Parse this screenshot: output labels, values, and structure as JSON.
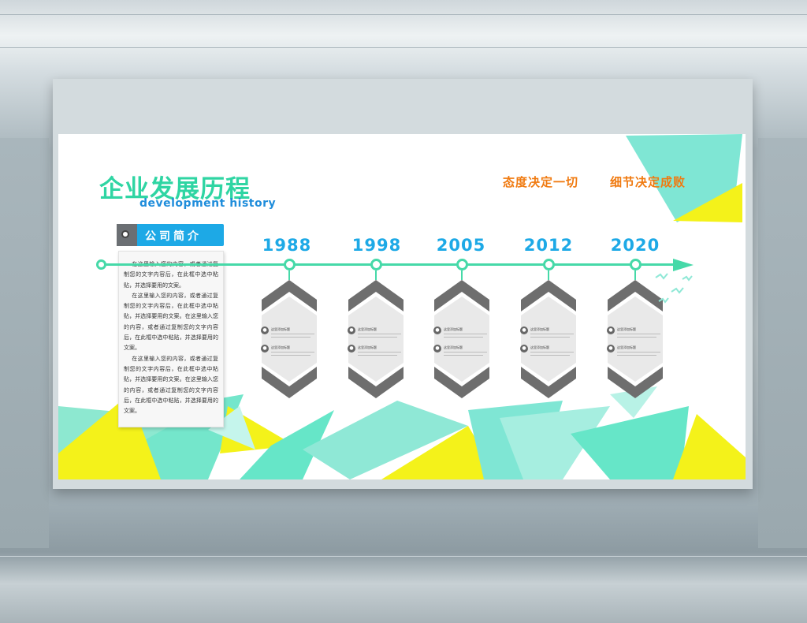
{
  "colors": {
    "teal": "#2fd5a3",
    "blue": "#1da9e6",
    "orange": "#f07a10",
    "yellow": "#f4f21a",
    "mint": "#66e6c8",
    "grey": "#6b6f73"
  },
  "board": {
    "title_cn": "企业发展历程",
    "title_en": "development history",
    "slogans": [
      "态度决定一切",
      "细节决定成败"
    ]
  },
  "intro": {
    "title": "公司简介",
    "text": "    在这里输入您的内容，或者通过复制您的文字内容后，在此框中选中粘贴，并选择要用的文案。\n    在这里输入您的内容，或者通过复制您的文字内容后，在此框中选中粘贴，并选择要用的文案。在这里输入您的内容，或者通过复制您的文字内容后，在此框中选中粘贴，并选择要用的文案。\n    在这里输入您的内容，或者通过复制您的文字内容后，在此框中选中粘贴，并选择要用的文案。在这里输入您的内容，或者通过复制您的文字内容后，在此框中选中粘贴，并选择要用的文案。"
  },
  "timeline": {
    "years": [
      "1988",
      "1998",
      "2005",
      "2012",
      "2020"
    ],
    "item_label": "这里添加标题"
  }
}
